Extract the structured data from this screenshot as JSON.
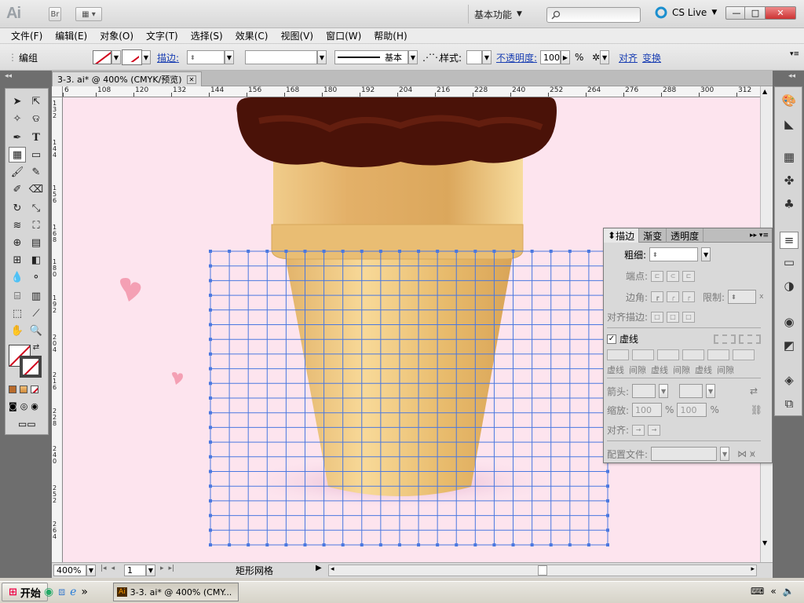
{
  "app": {
    "logo": "Ai",
    "br_label": "Br"
  },
  "workspace": {
    "label": "基本功能"
  },
  "cs_live": {
    "label": "CS Live"
  },
  "window_controls": {
    "minimize": "—",
    "maximize": "□",
    "close": "✕"
  },
  "menu": [
    "文件(F)",
    "编辑(E)",
    "对象(O)",
    "文字(T)",
    "选择(S)",
    "效果(C)",
    "视图(V)",
    "窗口(W)",
    "帮助(H)"
  ],
  "control_bar": {
    "mode": "编组",
    "stroke_label": "描边:",
    "stroke_style": "基本",
    "style_label": "样式:",
    "opacity_label": "不透明度:",
    "opacity_value": "100",
    "opacity_unit": "%",
    "align_label": "对齐",
    "transform_label": "变换"
  },
  "document": {
    "tab_title": "3-3. ai* @ 400% (CMYK/预览)"
  },
  "ruler": {
    "h_ticks": [
      "6",
      "108",
      "120",
      "132",
      "144",
      "156",
      "168",
      "180",
      "192",
      "204",
      "216",
      "228",
      "240",
      "252",
      "264",
      "276",
      "288",
      "300",
      "312"
    ]
  },
  "status": {
    "zoom": "400%",
    "page": "1",
    "info": "矩形网格"
  },
  "stroke_panel": {
    "tabs": [
      "描边",
      "渐变",
      "透明度"
    ],
    "weight_label": "粗细:",
    "cap_label": "端点:",
    "corner_label": "边角:",
    "limit_label": "限制:",
    "limit_unit": "x",
    "align_label": "对齐描边:",
    "dashed_label": "虚线",
    "dash_labels": [
      "虚线",
      "间隙",
      "虚线",
      "间隙",
      "虚线",
      "间隙"
    ],
    "arrow_label": "箭头:",
    "scale_label": "缩放:",
    "scale_values": [
      "100",
      "100"
    ],
    "scale_unit": "%",
    "align2_label": "对齐:",
    "profile_label": "配置文件:"
  },
  "taskbar": {
    "start": "开始",
    "task": "3-3. ai* @ 400% (CMY..."
  }
}
